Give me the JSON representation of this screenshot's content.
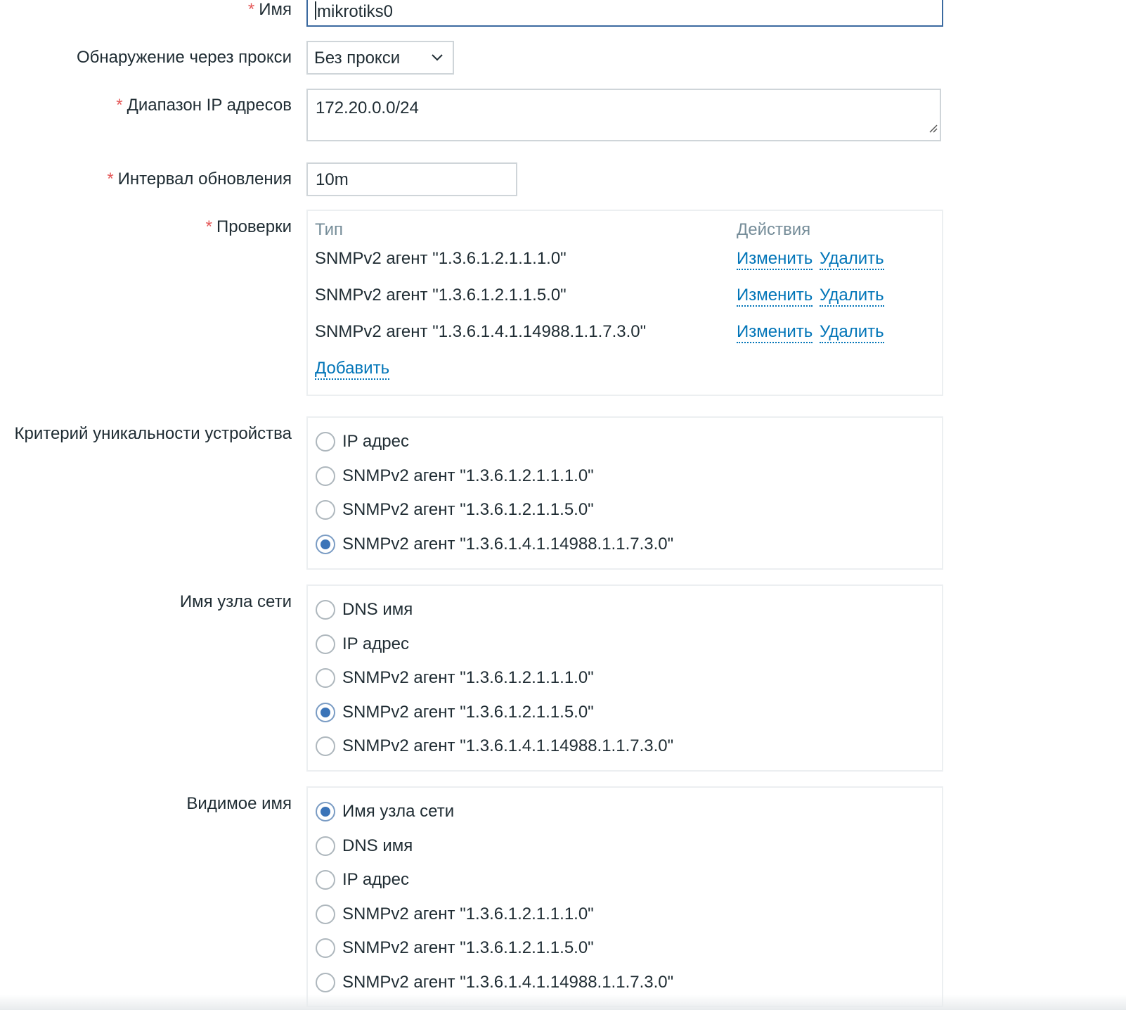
{
  "fields": {
    "name": {
      "label": "Имя",
      "required": true,
      "value": "mikrotiks0"
    },
    "proxy": {
      "label": "Обнаружение через прокси",
      "value": "Без прокси"
    },
    "ip_range": {
      "label": "Диапазон IP адресов",
      "required": true,
      "value": "172.20.0.0/24"
    },
    "interval": {
      "label": "Интервал обновления",
      "required": true,
      "value": "10m"
    }
  },
  "required_mark": "*",
  "checks": {
    "label": "Проверки",
    "required": true,
    "col_type": "Тип",
    "col_actions": "Действия",
    "rows": [
      {
        "type": "SNMPv2 агент \"1.3.6.1.2.1.1.1.0\"",
        "edit": "Изменить",
        "remove": "Удалить"
      },
      {
        "type": "SNMPv2 агент \"1.3.6.1.2.1.1.5.0\"",
        "edit": "Изменить",
        "remove": "Удалить"
      },
      {
        "type": "SNMPv2 агент \"1.3.6.1.4.1.14988.1.1.7.3.0\"",
        "edit": "Изменить",
        "remove": "Удалить"
      }
    ],
    "add": "Добавить"
  },
  "uniqueness": {
    "label": "Критерий уникальности устройства",
    "selected": 3,
    "options": [
      "IP адрес",
      "SNMPv2 агент \"1.3.6.1.2.1.1.1.0\"",
      "SNMPv2 агент \"1.3.6.1.2.1.1.5.0\"",
      "SNMPv2 агент \"1.3.6.1.4.1.14988.1.1.7.3.0\""
    ]
  },
  "host_name": {
    "label": "Имя узла сети",
    "selected": 3,
    "options": [
      "DNS имя",
      "IP адрес",
      "SNMPv2 агент \"1.3.6.1.2.1.1.1.0\"",
      "SNMPv2 агент \"1.3.6.1.2.1.1.5.0\"",
      "SNMPv2 агент \"1.3.6.1.4.1.14988.1.1.7.3.0\""
    ]
  },
  "visible_name": {
    "label": "Видимое имя",
    "selected": 0,
    "options": [
      "Имя узла сети",
      "DNS имя",
      "IP адрес",
      "SNMPv2 агент \"1.3.6.1.2.1.1.1.0\"",
      "SNMPv2 агент \"1.3.6.1.2.1.1.5.0\"",
      "SNMPv2 агент \"1.3.6.1.4.1.14988.1.1.7.3.0\""
    ]
  },
  "colors": {
    "link": "#0275b8",
    "required": "#e45959",
    "radio_selected": "#3b74b8",
    "focus_border": "#3b6aa0"
  },
  "icons": {
    "select": "chevron-down-icon",
    "textarea": "resize-grip-icon"
  }
}
